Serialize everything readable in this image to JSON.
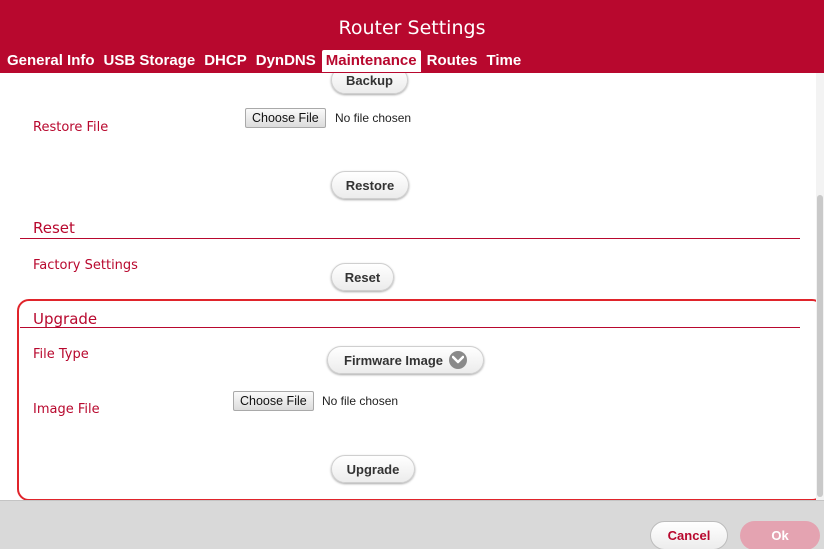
{
  "header": {
    "title": "Router Settings",
    "tabs": [
      {
        "label": "General Info"
      },
      {
        "label": "USB Storage"
      },
      {
        "label": "DHCP"
      },
      {
        "label": "DynDNS"
      },
      {
        "label": "Maintenance",
        "active": true
      },
      {
        "label": "Routes"
      },
      {
        "label": "Time"
      }
    ]
  },
  "backup": {
    "button_label": "Backup"
  },
  "restore": {
    "label": "Restore File",
    "choose_file_label": "Choose File",
    "file_status": "No file chosen",
    "button_label": "Restore"
  },
  "reset": {
    "section_title": "Reset",
    "label": "Factory Settings",
    "button_label": "Reset"
  },
  "upgrade": {
    "section_title": "Upgrade",
    "file_type_label": "File Type",
    "file_type_value": "Firmware Image",
    "image_file_label": "Image File",
    "choose_file_label": "Choose File",
    "file_status": "No file chosen",
    "button_label": "Upgrade"
  },
  "footer": {
    "cancel_label": "Cancel",
    "ok_label": "Ok"
  },
  "colors": {
    "brand": "#b8082e",
    "highlight": "#e0242b",
    "ok_disabled": "#e4a3b1"
  }
}
